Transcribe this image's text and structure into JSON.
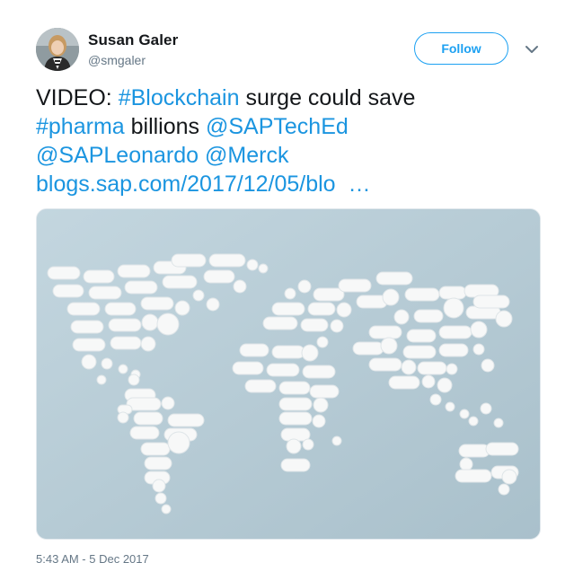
{
  "user": {
    "name": "Susan Galer",
    "handle": "@smgaler"
  },
  "follow_label": "Follow",
  "tweet": {
    "line1_plain": "VIDEO: ",
    "line1_hashtag": "#Blockchain",
    "line1_rest": " surge could save",
    "line2_hashtag": "#pharma",
    "line2_plain": " billions ",
    "line2_mention": "@SAPTechEd",
    "line3_mention1": "@SAPLeonardo",
    "line3_mention2": "@Merck",
    "line4_link": "blogs.sap.com/2017/12/05/blo",
    "line4_ellipsis": "…"
  },
  "media": {
    "description_icon": "pill-world-map-image"
  },
  "timestamp": "5:43 AM - 5 Dec 2017",
  "colors": {
    "accent": "#1da1f2",
    "link": "#1b95e0",
    "muted": "#657786"
  }
}
